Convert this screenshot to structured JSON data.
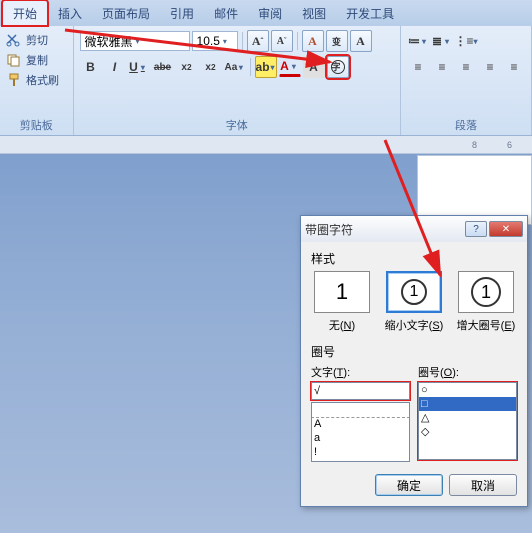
{
  "tabs": [
    "开始",
    "插入",
    "页面布局",
    "引用",
    "邮件",
    "审阅",
    "视图",
    "开发工具"
  ],
  "active_tab_index": 0,
  "clipboard": {
    "cut": "剪切",
    "copy": "复制",
    "format_painter": "格式刷",
    "group_label": "剪贴板"
  },
  "font": {
    "name": "微软雅黑",
    "size": "10.5",
    "group_label": "字体",
    "buttons_row1": [
      "A",
      "A",
      "A",
      "文",
      "A"
    ],
    "buttons_row2": [
      "B",
      "I",
      "U",
      "abe",
      "x₂",
      "x²",
      "Aa",
      "ab",
      "A",
      "A",
      "A",
      "字"
    ]
  },
  "paragraph": {
    "group_label": "段落"
  },
  "ruler": {
    "marks": [
      "8",
      "6"
    ]
  },
  "dialog": {
    "title": "带圈字符",
    "style_label": "样式",
    "styles": [
      {
        "glyph": "1",
        "caption": "无",
        "access": "N",
        "circled": false
      },
      {
        "glyph": "①",
        "caption": "缩小文字",
        "access": "S",
        "circled": true,
        "selected": true
      },
      {
        "glyph": "①",
        "caption": "增大圈号",
        "access": "E",
        "circled": true,
        "big": true
      }
    ],
    "enclosure_label": "圈号",
    "text_label": "文字",
    "text_access": "T",
    "shape_label": "圈号",
    "shape_access": "O",
    "text_value": "√",
    "text_list": [
      "",
      "A",
      "a",
      "!"
    ],
    "shape_list": [
      "○",
      "□",
      "△",
      "◇"
    ],
    "shape_selected_index": 1,
    "ok": "确定",
    "cancel": "取消"
  }
}
